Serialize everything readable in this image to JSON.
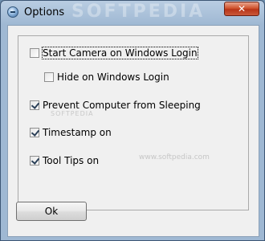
{
  "window": {
    "title": "Options",
    "watermark": "SOFTPEDIA",
    "close_symbol": "✕"
  },
  "options": [
    {
      "label": "Start Camera on Windows Login",
      "checked": false
    },
    {
      "label": "Hide on Windows Login",
      "checked": false
    },
    {
      "label": "Prevent Computer from Sleeping",
      "checked": true
    },
    {
      "label": "Timestamp on",
      "checked": true
    },
    {
      "label": "Tool Tips on",
      "checked": true
    }
  ],
  "watermarks": {
    "url": "www.softpedia.com",
    "faint": "SOFTPEDIA"
  },
  "ok_label": "Ok",
  "icons": {
    "app": "camera-app-icon",
    "close": "close-icon"
  }
}
